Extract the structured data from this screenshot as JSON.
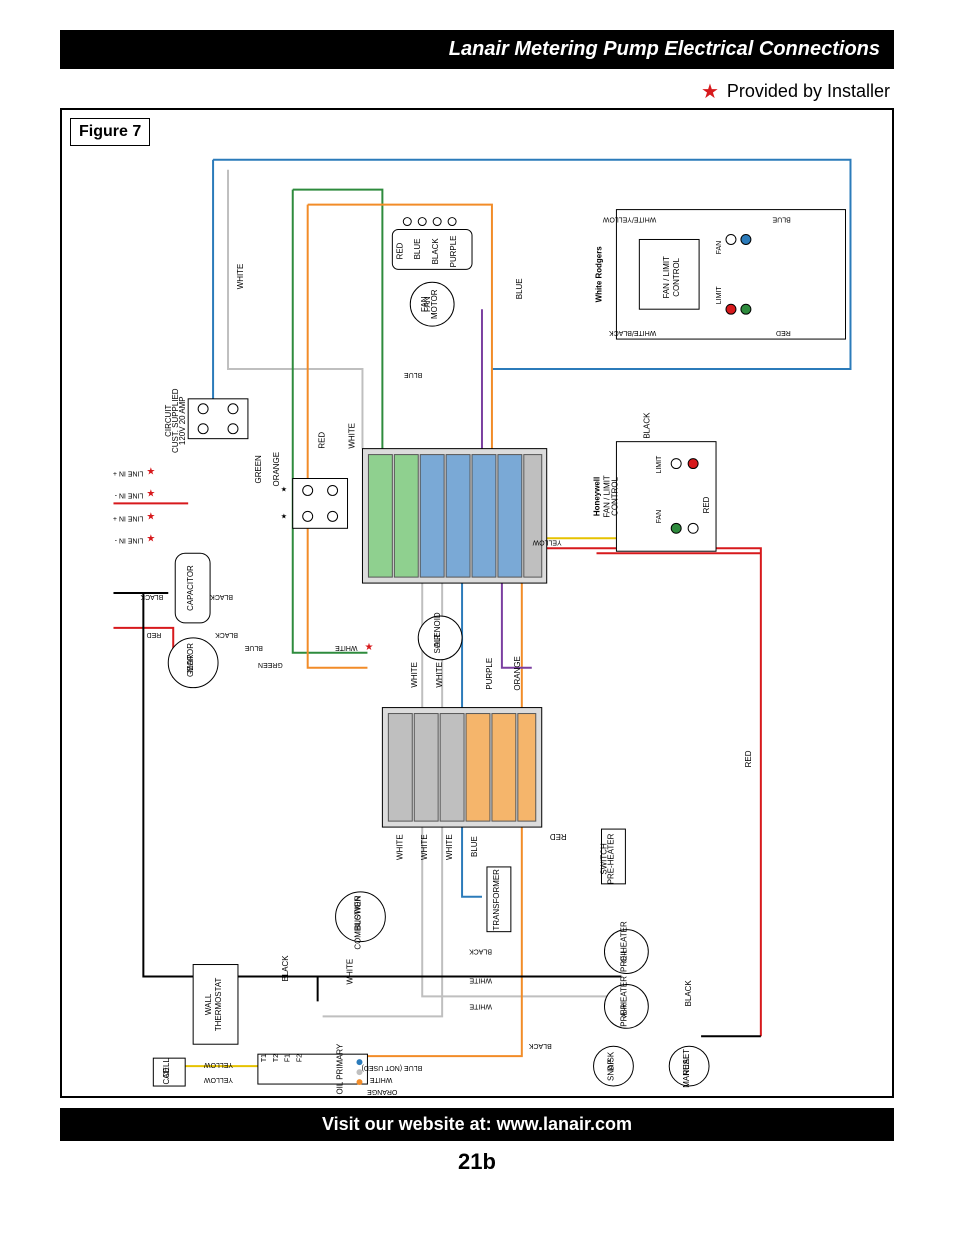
{
  "header_title": "Lanair Metering Pump Electrical Connections",
  "legend": {
    "star_glyph": "★",
    "text": "Provided by Installer"
  },
  "figure_label": "Figure 7",
  "components": {
    "fan_motor": "FAN MOTOR",
    "circuit_supplied": "CIRCUIT CUST. SUPPLIED 120V 20 AMP",
    "white_rodgers": "White Rodgers",
    "white_rodgers_sub": "FAN / LIMIT CONTROL",
    "honeywell": "Honeywell",
    "honeywell_sub": "FAN / LIMIT CONTROL",
    "capacitor": "CAPACITOR",
    "gear_motor": "GEAR MOTOR",
    "air_solenoid": "AIR SOLENOID",
    "combustion_blower": "COMBUSTION BLOWER",
    "transformer": "TRANSFORMER",
    "pre_heater_switch": "PRE-HEATER SWITCH",
    "wall_thermostat": "WALL THERMOSTAT",
    "cad_cell": "CAD CELL",
    "oil_primary": "OIL PRIMARY",
    "snap_disk": "SNAP DISK",
    "oil_pre_heater": "OIL PRE-HEATER",
    "air_pre_heater": "AIR PRE-HEATER",
    "manual_reset": "MANUAL RESET",
    "fan": "FAN",
    "limit": "LIMIT",
    "line_in_plus": "LINE IN +",
    "line_in_minus": "LINE IN -"
  },
  "terminals": {
    "t1": "T1",
    "t2": "T2",
    "f1": "F1",
    "f2": "F2"
  },
  "wire_colors": {
    "white": "WHITE",
    "red": "RED",
    "blue": "BLUE",
    "black": "BLACK",
    "purple": "PURPLE",
    "green": "GREEN",
    "orange": "ORANGE",
    "yellow": "YELLOW",
    "white_yellow": "WHITE/YELLOW",
    "white_black": "WHITE/BLACK",
    "blue_not_used": "BLUE (NOT USED)"
  },
  "footer": "Visit our website at: www.lanair.com",
  "page": "21b"
}
